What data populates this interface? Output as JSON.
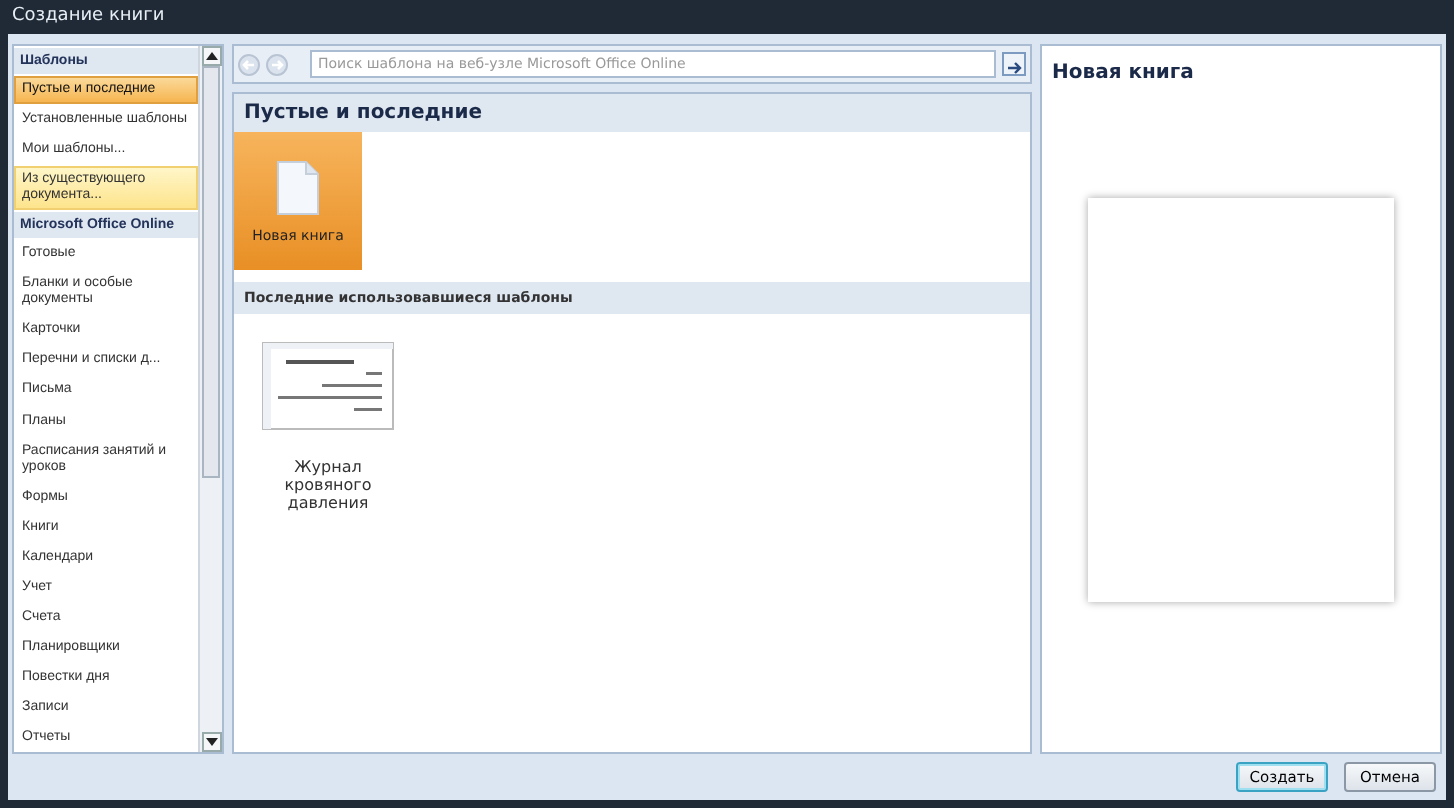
{
  "window": {
    "title": "Создание книги"
  },
  "sidebar": {
    "items": [
      {
        "kind": "header",
        "label": "Шаблоны"
      },
      {
        "kind": "item",
        "label": "Пустые и последние",
        "selected": true,
        "hovered": false
      },
      {
        "kind": "item",
        "label": "Установленные шаблоны",
        "selected": false,
        "hovered": false
      },
      {
        "kind": "item",
        "label": "Мои шаблоны...",
        "selected": false,
        "hovered": false
      },
      {
        "kind": "item",
        "label": "Из существующего документа...",
        "selected": false,
        "hovered": true
      },
      {
        "kind": "header",
        "label": "Microsoft Office Online"
      },
      {
        "kind": "item",
        "label": "Готовые",
        "selected": false,
        "hovered": false
      },
      {
        "kind": "item",
        "label": "Бланки и особые документы",
        "selected": false,
        "hovered": false
      },
      {
        "kind": "item",
        "label": "Карточки",
        "selected": false,
        "hovered": false
      },
      {
        "kind": "item",
        "label": "Перечни и списки д...",
        "selected": false,
        "hovered": false
      },
      {
        "kind": "item",
        "label": "Письма",
        "selected": false,
        "hovered": false
      },
      {
        "kind": "item",
        "label": "Планы",
        "selected": false,
        "hovered": false
      },
      {
        "kind": "item",
        "label": "Расписания занятий и уроков",
        "selected": false,
        "hovered": false
      },
      {
        "kind": "item",
        "label": "Формы",
        "selected": false,
        "hovered": false
      },
      {
        "kind": "item",
        "label": "Книги",
        "selected": false,
        "hovered": false
      },
      {
        "kind": "item",
        "label": "Календари",
        "selected": false,
        "hovered": false
      },
      {
        "kind": "item",
        "label": "Учет",
        "selected": false,
        "hovered": false
      },
      {
        "kind": "item",
        "label": "Счета",
        "selected": false,
        "hovered": false
      },
      {
        "kind": "item",
        "label": "Планировщики",
        "selected": false,
        "hovered": false
      },
      {
        "kind": "item",
        "label": "Повестки дня",
        "selected": false,
        "hovered": false
      },
      {
        "kind": "item",
        "label": "Записи",
        "selected": false,
        "hovered": false
      },
      {
        "kind": "item",
        "label": "Отчеты",
        "selected": false,
        "hovered": false
      }
    ]
  },
  "search": {
    "placeholder": "Поиск шаблона на веб-узле Microsoft Office Online"
  },
  "main": {
    "title": "Пустые и последние",
    "blank_templates": [
      {
        "label": "Новая книга",
        "selected": true
      }
    ],
    "recent_section": "Последние использовавшиеся шаблоны",
    "recent_templates": [
      {
        "label": "Журнал кровяного давления",
        "selected": false
      }
    ]
  },
  "preview": {
    "title": "Новая книга"
  },
  "buttons": [
    {
      "label": "Создать",
      "kind": "default"
    },
    {
      "label": "Отмена",
      "kind": "normal"
    }
  ]
}
